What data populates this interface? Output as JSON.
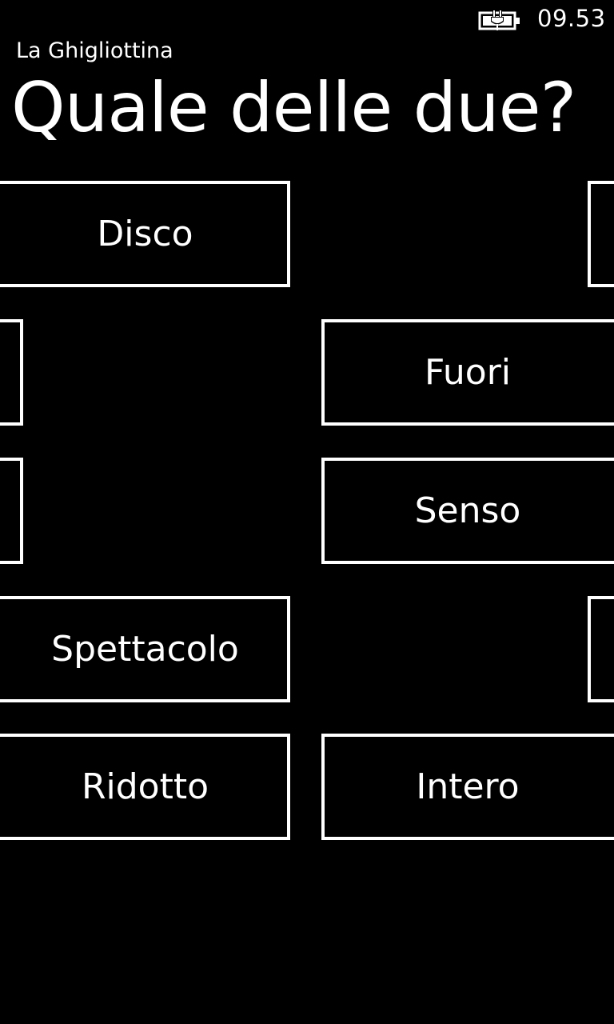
{
  "status_bar": {
    "time": "09.53",
    "battery_icon": "battery-charging-icon"
  },
  "header": {
    "app_title": "La Ghigliottina",
    "page_title": "Quale delle due?"
  },
  "rows": [
    {
      "left": "Disco",
      "right": ""
    },
    {
      "left": "",
      "right": "Fuori"
    },
    {
      "left": "",
      "right": "Senso"
    },
    {
      "left": "Spettacolo",
      "right": ""
    },
    {
      "left": "Ridotto",
      "right": "Intero"
    }
  ],
  "colors": {
    "background": "#000000",
    "foreground": "#ffffff"
  }
}
